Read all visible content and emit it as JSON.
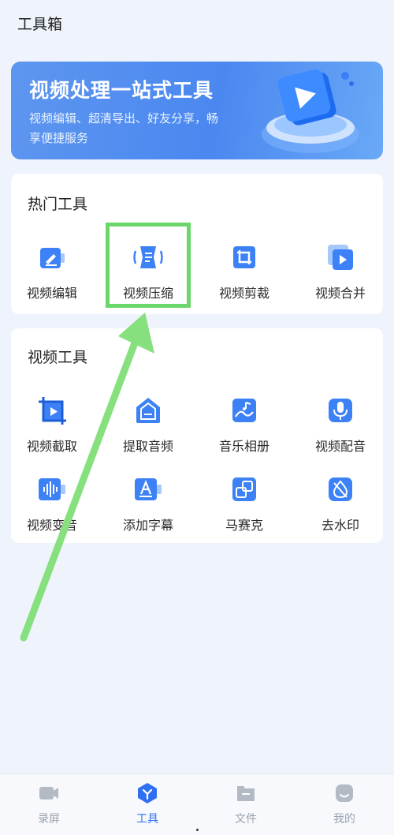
{
  "header": {
    "title": "工具箱"
  },
  "banner": {
    "title": "视频处理一站式工具",
    "description": "视频编辑、超清导出、好友分享，畅享便捷服务"
  },
  "hot_tools": {
    "title": "热门工具",
    "items": [
      {
        "label": "视频编辑",
        "icon": "edit-icon"
      },
      {
        "label": "视频压缩",
        "icon": "compress-icon"
      },
      {
        "label": "视频剪裁",
        "icon": "crop-icon"
      },
      {
        "label": "视频合并",
        "icon": "merge-icon"
      }
    ]
  },
  "video_tools": {
    "title": "视频工具",
    "items": [
      {
        "label": "视频截取",
        "icon": "trim-icon"
      },
      {
        "label": "提取音频",
        "icon": "extract-audio-icon"
      },
      {
        "label": "音乐相册",
        "icon": "music-album-icon"
      },
      {
        "label": "视频配音",
        "icon": "microphone-icon"
      },
      {
        "label": "视频变音",
        "icon": "voice-change-icon"
      },
      {
        "label": "添加字幕",
        "icon": "subtitle-icon"
      },
      {
        "label": "马赛克",
        "icon": "mosaic-icon"
      },
      {
        "label": "去水印",
        "icon": "remove-watermark-icon"
      }
    ]
  },
  "tabbar": {
    "items": [
      {
        "label": "录屏",
        "icon": "camera-icon",
        "active": false
      },
      {
        "label": "工具",
        "icon": "tools-icon",
        "active": true
      },
      {
        "label": "文件",
        "icon": "folder-icon",
        "active": false
      },
      {
        "label": "我的",
        "icon": "profile-icon",
        "active": false
      }
    ]
  },
  "colors": {
    "accent": "#2f6ff2",
    "icon_blue": "#3c82f6",
    "banner": "#4a88f0",
    "highlight": "#6bd66a",
    "background": "#eff3fb"
  }
}
